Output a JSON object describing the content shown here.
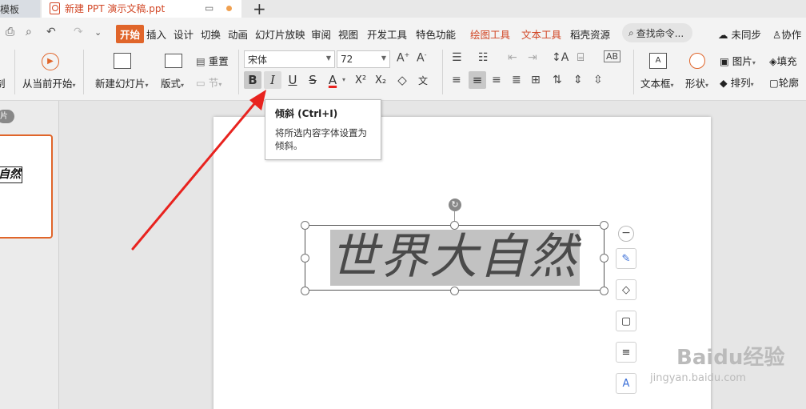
{
  "tabs": {
    "prev": "模板",
    "active": "新建 PPT 演示文稿.ppt",
    "plus": "+"
  },
  "menu": {
    "start": "开始",
    "items": [
      "插入",
      "设计",
      "切换",
      "动画",
      "幻灯片放映",
      "审阅",
      "视图",
      "开发工具",
      "特色功能"
    ],
    "drawing_tools": "绘图工具",
    "text_tools": "文本工具",
    "resources": "稻壳资源",
    "search": "查找命令...",
    "sync": "未同步",
    "collab": "协作"
  },
  "ribbon": {
    "play_label": "从当前开始",
    "new_slide_label": "新建幻灯片",
    "layout_label": "版式",
    "reset_label": "重置",
    "section_label": "节",
    "font_name": "宋体",
    "font_size": "72",
    "bold": "B",
    "italic": "I",
    "underline": "U",
    "strike": "S",
    "fontcolor": "A",
    "superscript": "X²",
    "subscript": "X₂",
    "textbox_label": "文本框",
    "shape_label": "形状",
    "picture_label": "图片",
    "fill_label": "填充",
    "arrange_label": "排列",
    "outline_label": "轮廓"
  },
  "tooltip": {
    "title": "倾斜 (Ctrl+I)",
    "description": "将所选内容字体设置为倾斜。"
  },
  "slide": {
    "thumbnail_badge": "片",
    "thumbnail_text": "自然",
    "main_text": "世界大自然"
  },
  "watermark": {
    "text": "Baidu经验",
    "url": "jingyan.baidu.com"
  },
  "colors": {
    "accent": "#e0652a",
    "arrow": "#e8231f"
  }
}
